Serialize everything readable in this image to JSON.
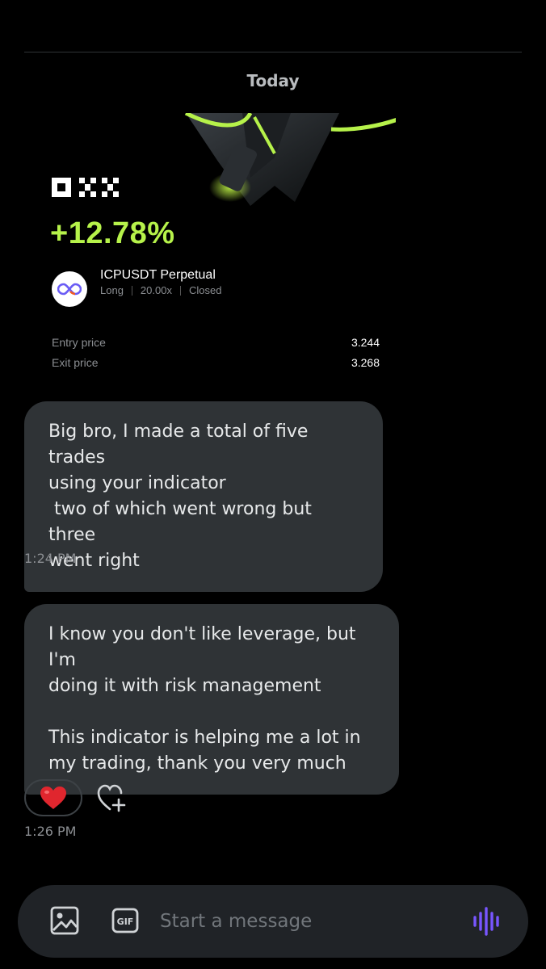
{
  "date_separator": "Today",
  "trade_card": {
    "brand": "OKX",
    "pnl": "+12.78%",
    "pair": "ICPUSDT Perpetual",
    "side": "Long",
    "leverage": "20.00x",
    "status": "Closed",
    "entry_label": "Entry price",
    "entry_value": "3.244",
    "exit_label": "Exit price",
    "exit_value": "3.268",
    "accent_color": "#b6f24a"
  },
  "messages": [
    {
      "text": "Big bro, I made a total of five trades\nusing your indicator\n two of which went wrong but three\nwent right",
      "time": "1:24 PM"
    },
    {
      "text": "I know you don't like leverage, but I'm\ndoing it with risk management\n\nThis indicator is helping me a lot in\nmy trading, thank you very much",
      "time": "1:26 PM",
      "reaction": "heart-emoji"
    }
  ],
  "composer": {
    "placeholder": "Start a message",
    "gif_label": "GIF",
    "icons": [
      "image-icon",
      "gif-icon",
      "voice-icon"
    ],
    "accent_color": "#7856ff"
  }
}
